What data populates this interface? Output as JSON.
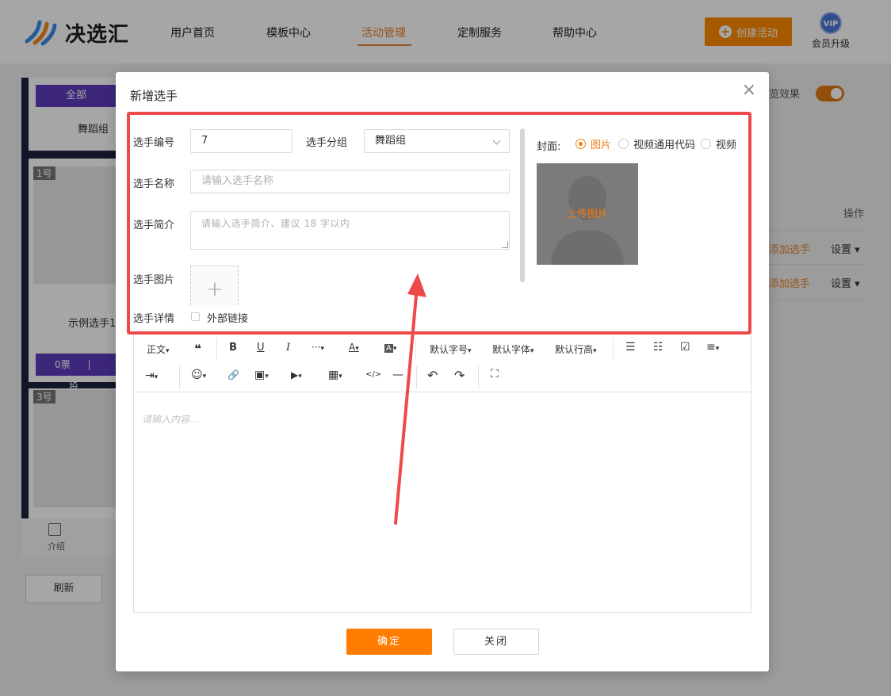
{
  "topbar": {
    "brand": "决选汇",
    "nav": [
      "用户首页",
      "模板中心",
      "活动管理",
      "定制服务",
      "帮助中心"
    ],
    "active_nav": "活动管理",
    "create_label": "创建活动",
    "vip_badge": "VIP",
    "vip_label": "会员升级"
  },
  "left_panel": {
    "filter_all": "全部",
    "group_name": "舞蹈组",
    "card1_num": "1号",
    "card1_name": "示例选手1",
    "card1_votes": "0票",
    "card1_sep": "|",
    "card1_action": "投",
    "card2_num": "3号",
    "tab_label": "介绍",
    "refresh_label": "刷新"
  },
  "right_bg": {
    "preview_label": "览效果",
    "op_label": "操作",
    "rows": [
      {
        "add": "添加选手",
        "set": "设置"
      },
      {
        "add": "添加选手",
        "set": "设置"
      }
    ]
  },
  "modal": {
    "title": "新增选手",
    "close_icon": "×",
    "fields": {
      "number_label": "选手编号",
      "number_value": "7",
      "group_label": "选手分组",
      "group_value": "舞蹈组",
      "name_label": "选手名称",
      "name_placeholder": "请输入选手名称",
      "intro_label": "选手简介",
      "intro_placeholder": "请输入选手简介、建议 18 字以内",
      "image_label": "选手图片",
      "detail_label": "选手详情",
      "external_link_label": "外部链接"
    },
    "cover": {
      "label": "封面:",
      "options": [
        "图片",
        "视频通用代码",
        "视频"
      ],
      "selected": "图片",
      "upload_label": "上传图片"
    },
    "toolbar": {
      "paragraph": "正文",
      "quote": "❝",
      "bold": "B",
      "underline": "U",
      "italic": "I",
      "more": "···",
      "font_color": "A",
      "bg_color": "A",
      "font_size": "默认字号",
      "font_family": "默认字体",
      "line_height": "默认行高",
      "bullet_list": "☰",
      "numbered_list": "☷",
      "todo": "☑",
      "align": "≡",
      "indent": "⇥",
      "emoji": "☺",
      "link": "🔗",
      "image": "▣",
      "video": "▶",
      "table": "▦",
      "code": "</>",
      "divider": "—",
      "undo": "↶",
      "redo": "↷",
      "fullscreen": "⛶",
      "caret": "▾"
    },
    "editor_placeholder": "请输入内容...",
    "confirm_label": "确定",
    "close_label": "关闭"
  },
  "colors": {
    "accent": "#ff7c00",
    "highlight": "#ef4a4a",
    "purple": "#5c3dbd"
  }
}
